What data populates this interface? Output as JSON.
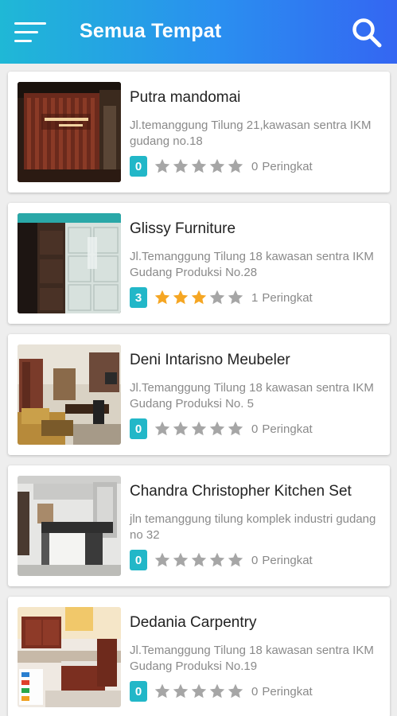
{
  "header": {
    "title": "Semua Tempat",
    "menu_icon": "menu-icon",
    "search_icon": "search-icon",
    "colors": {
      "gradient_start": "#1fb8d6",
      "gradient_end": "#3466f2"
    }
  },
  "colors": {
    "score_badge": "#22b7c8",
    "star_filled": "#f5a623",
    "star_empty": "#a6a6a6"
  },
  "places": [
    {
      "name": "Putra mandomai",
      "address": "Jl.temanggung Tilung 21,kawasan sentra IKM  gudang no.18",
      "score": "0",
      "rating": 0,
      "count": "0",
      "count_label": "Peringkat",
      "photo": "storefront-photo"
    },
    {
      "name": "Glissy Furniture",
      "address": "Jl.Temanggung Tilung 18 kawasan sentra IKM Gudang Produksi No.28",
      "score": "3",
      "rating": 3,
      "count": "1",
      "count_label": "Peringkat",
      "photo": "wardrobe-photo"
    },
    {
      "name": "Deni Intarisno Meubeler",
      "address": "Jl.Temanggung Tilung 18 kawasan sentra IKM Gudang Produksi No. 5",
      "score": "0",
      "rating": 0,
      "count": "0",
      "count_label": "Peringkat",
      "photo": "living-room-photo"
    },
    {
      "name": "Chandra Christopher Kitchen Set",
      "address": "jln temanggung tilung komplek industri gudang no 32",
      "score": "0",
      "rating": 0,
      "count": "0",
      "count_label": "Peringkat",
      "photo": "kitchen-bar-photo"
    },
    {
      "name": "Dedania Carpentry",
      "address": "Jl.Temanggung Tilung 18 kawasan sentra IKM Gudang Produksi No.19",
      "score": "0",
      "rating": 0,
      "count": "0",
      "count_label": "Peringkat",
      "photo": "kitchen-set-photo"
    }
  ]
}
